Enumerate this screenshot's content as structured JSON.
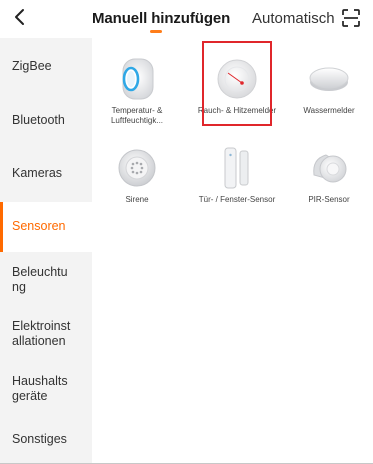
{
  "header": {
    "back_icon": "chevron-left-icon",
    "tab_manual": "Manuell hinzufügen",
    "tab_auto": "Automatisch",
    "scan_icon": "scan-icon",
    "accent": "#ff7d1a"
  },
  "sidebar": {
    "items": [
      {
        "label": "ZigBee"
      },
      {
        "label": "Bluetooth"
      },
      {
        "label": "Kameras"
      },
      {
        "label": "Sensoren",
        "active": true
      },
      {
        "label": "Beleuchtu ng"
      },
      {
        "label": "Elektroinst allationen"
      },
      {
        "label": "Haushalts geräte"
      },
      {
        "label": "Sonstiges"
      }
    ],
    "active_color": "#ff6a00"
  },
  "devices": [
    {
      "label": "Temperatur- & Luftfeuchtigk...",
      "icon": "temperature-humidity-sensor-icon"
    },
    {
      "label": "Rauch- & Hitzemelder",
      "icon": "smoke-heat-detector-icon",
      "highlighted": true
    },
    {
      "label": "Wassermelder",
      "icon": "water-leak-sensor-icon"
    },
    {
      "label": "Sirene",
      "icon": "siren-icon"
    },
    {
      "label": "Tür- / Fenster-Sensor",
      "icon": "door-window-sensor-icon"
    },
    {
      "label": "PIR-Sensor",
      "icon": "pir-sensor-icon"
    }
  ],
  "highlight_color": "#e0262b"
}
